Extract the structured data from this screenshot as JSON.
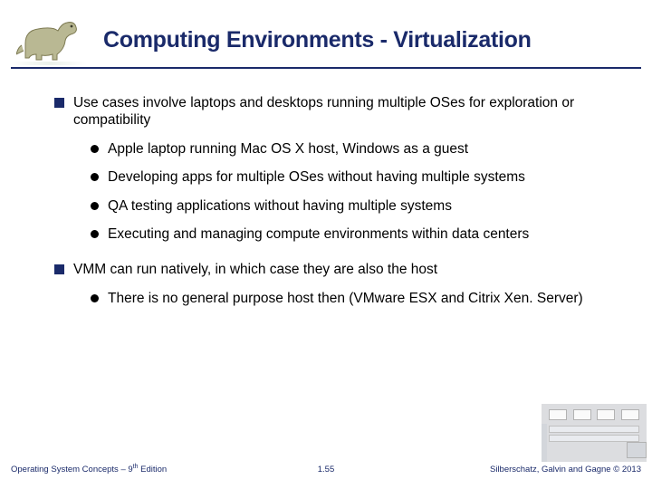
{
  "title": "Computing Environments - Virtualization",
  "bullets": {
    "b1": "Use cases involve laptops and desktops running multiple OSes for exploration or compatibility",
    "b1_1": "Apple laptop running Mac OS X host, Windows as a guest",
    "b1_2": "Developing apps for multiple OSes without having multiple systems",
    "b1_3": "QA testing applications without having multiple systems",
    "b1_4": "Executing and managing compute environments within data centers",
    "b2": "VMM can run natively, in which case they are also the host",
    "b2_1": "There is no general purpose host then (VMware ESX and Citrix Xen. Server)"
  },
  "footer": {
    "left_a": "Operating System Concepts – 9",
    "left_sup": "th",
    "left_b": " Edition",
    "center": "1.55",
    "right": "Silberschatz, Galvin and Gagne © 2013"
  },
  "icons": {
    "logo": "dinosaur-icon"
  }
}
